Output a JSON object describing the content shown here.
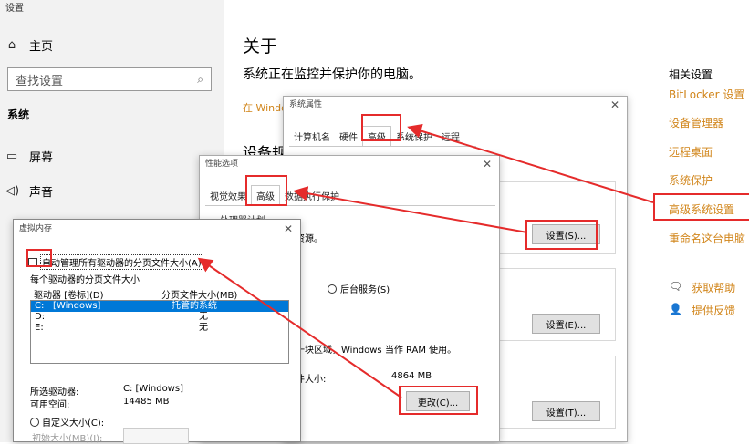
{
  "window": {
    "title": "设置"
  },
  "sidebar": {
    "home_label": "主页",
    "search_placeholder": "查找设置",
    "section_title": "系统",
    "items": [
      {
        "label": "屏幕",
        "icon": "monitor-icon"
      },
      {
        "label": "声音",
        "icon": "speaker-icon"
      }
    ]
  },
  "main": {
    "title": "关于",
    "subtitle": "系统正在监控并保护你的电脑。",
    "link_partial": "在 Windo",
    "section_partial": "设备规"
  },
  "related": {
    "title": "相关设置",
    "links": [
      "BitLocker 设置",
      "设备管理器",
      "远程桌面",
      "系统保护",
      "高级系统设置",
      "重命名这台电脑"
    ],
    "help_label": "获取帮助",
    "feedback_label": "提供反馈"
  },
  "sysprops": {
    "title": "系统属性",
    "tabs": [
      "计算机名",
      "硬件",
      "高级",
      "系统保护",
      "远程"
    ],
    "selected_tab": "高级",
    "settings_btn_1": "设置(S)...",
    "settings_btn_2": "设置(E)...",
    "settings_btn_3": "设置(T)..."
  },
  "perf": {
    "title": "性能选项",
    "tabs": [
      "视觉效果",
      "高级",
      "数据执行保护"
    ],
    "selected_tab": "高级",
    "group_partial": "处理器计划",
    "resource_partial": "器资源。",
    "radio_bg": "后台服务(S)",
    "vm_desc_partial": "的一块区域，Windows 当作 RAM 使用。",
    "pagefile_label_partial": "文件大小:",
    "pagefile_size": "4864 MB",
    "change_btn": "更改(C)..."
  },
  "vmem": {
    "title": "虚拟内存",
    "auto_manage_label": "自动管理所有驱动器的分页文件大小(A)",
    "per_drive_label": "每个驱动器的分页文件大小",
    "col_drive": "驱动器 [卷标](D)",
    "col_pagefile": "分页文件大小(MB)",
    "rows": [
      {
        "drive": "C:",
        "label": "[Windows]",
        "size": "托管的系统"
      },
      {
        "drive": "D:",
        "label": "",
        "size": "无"
      },
      {
        "drive": "E:",
        "label": "",
        "size": "无"
      }
    ],
    "selected_drive_label": "所选驱动器:",
    "selected_drive_value": "C:  [Windows]",
    "free_space_label": "可用空间:",
    "free_space_value": "14485 MB",
    "custom_size_label": "自定义大小(C):",
    "initial_size_label": "初始大小(MB)(I):"
  },
  "colors": {
    "accent": "#d1851a",
    "highlight": "#e52b2b",
    "selection": "#0078d7"
  }
}
